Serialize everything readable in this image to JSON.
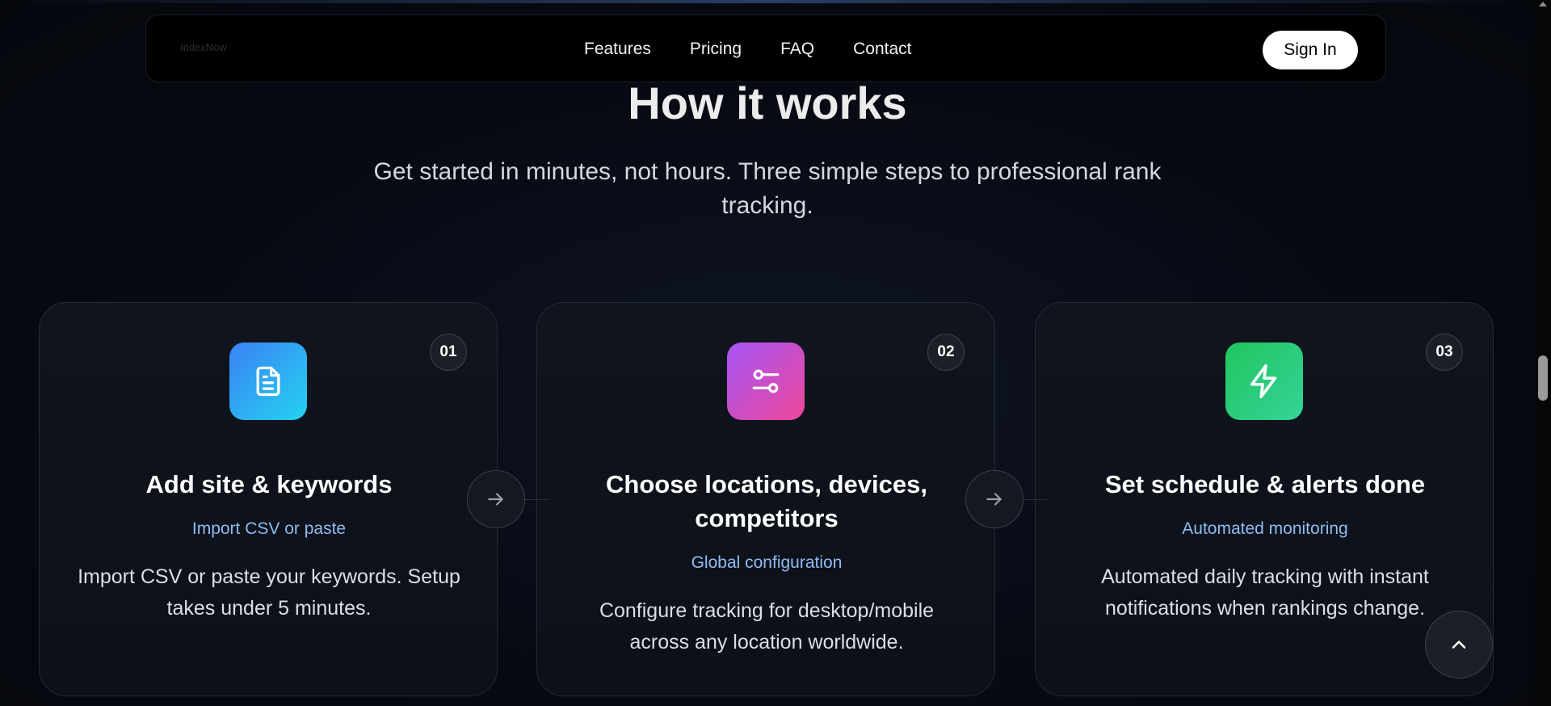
{
  "nav": {
    "logo": "IndexNow",
    "links": [
      "Features",
      "Pricing",
      "FAQ",
      "Contact"
    ],
    "signin_label": "Sign In"
  },
  "section": {
    "title": "How it works",
    "subtitle": "Get started in minutes, not hours. Three simple steps to professional rank tracking."
  },
  "steps": [
    {
      "number": "01",
      "icon": "document-icon",
      "title": "Add site & keywords",
      "tag": "Import CSV or paste",
      "description": "Import CSV or paste your keywords. Setup takes under 5 minutes.",
      "gradient": [
        "#3b82f6",
        "#22d3ee"
      ]
    },
    {
      "number": "02",
      "icon": "sliders-icon",
      "title": "Choose locations, devices, competitors",
      "tag": "Global configuration",
      "description": "Configure tracking for desktop/mobile across any location worldwide.",
      "gradient": [
        "#a855f7",
        "#ec4899"
      ]
    },
    {
      "number": "03",
      "icon": "lightning-icon",
      "title": "Set schedule & alerts done",
      "tag": "Automated monitoring",
      "description": "Automated daily tracking with instant notifications when rankings change.",
      "gradient": [
        "#22c55e",
        "#34d399"
      ]
    }
  ],
  "colors": {
    "accent_tag": "#8fbcf2",
    "background": "#070a13"
  }
}
